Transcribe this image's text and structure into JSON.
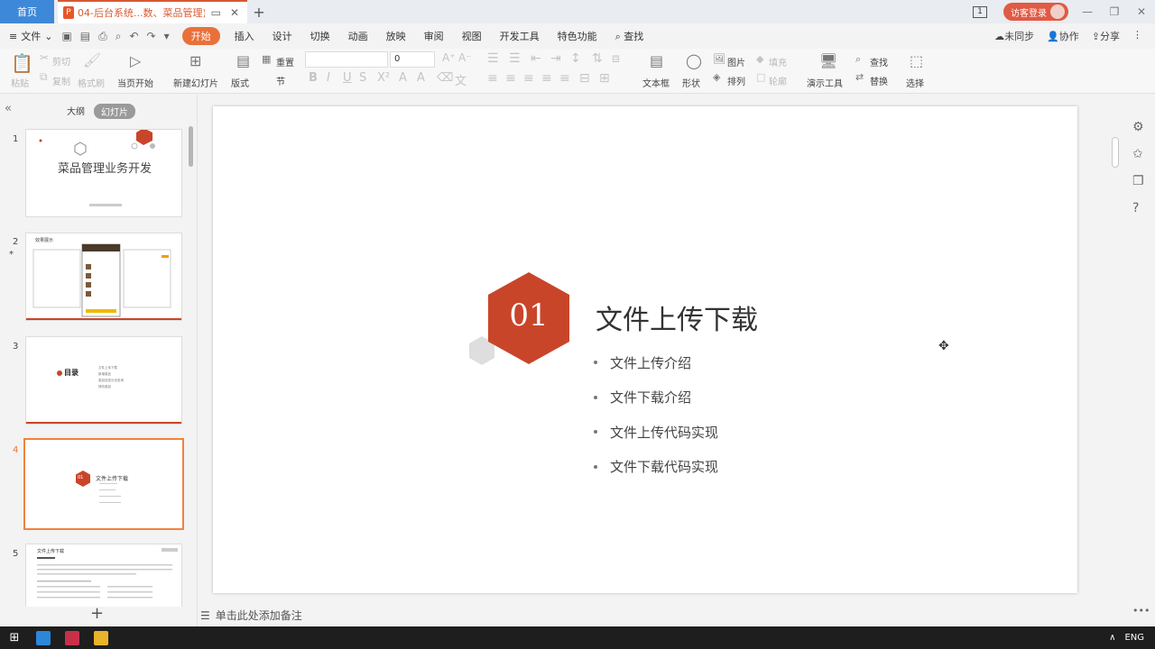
{
  "titlebar": {
    "home_tab": "首页",
    "doc_tab_title": "04-后台系统...数、菜品管理)",
    "doc_badge_count": "1",
    "login_label": "访客登录"
  },
  "menu": {
    "file": "文件",
    "items": [
      "开始",
      "插入",
      "设计",
      "切换",
      "动画",
      "放映",
      "审阅",
      "视图",
      "开发工具",
      "特色功能"
    ],
    "search": "查找",
    "right": [
      "未同步",
      "协作",
      "分享"
    ]
  },
  "ribbon": {
    "paste": "粘贴",
    "cut": "剪切",
    "copy": "复制",
    "format_painter": "格式刷",
    "play_from_current": "当页开始",
    "new_slide": "新建幻灯片",
    "layout": "版式",
    "section": "节",
    "reset": "重置",
    "font_size": "0",
    "textbox": "文本框",
    "shape": "形状",
    "picture": "图片",
    "fill": "填充",
    "arrange": "排列",
    "outline": "轮廓",
    "present_tools": "演示工具",
    "find": "查找",
    "replace": "替换",
    "select": "选择"
  },
  "panel": {
    "tab_outline": "大纲",
    "tab_slides": "幻灯片",
    "slides": [
      {
        "num": "1",
        "title": "菜品管理业务开发"
      },
      {
        "num": "2",
        "title": "效果展示"
      },
      {
        "num": "3",
        "title": "目录",
        "items": [
          "文件上传下载",
          "新增菜品",
          "菜品信息分页查询",
          "修改菜品"
        ]
      },
      {
        "num": "4",
        "badge": "01",
        "title": "文件上传下载"
      },
      {
        "num": "5",
        "title": "文件上传下载"
      }
    ]
  },
  "slide": {
    "badge": "01",
    "title": "文件上传下载",
    "bullets": [
      "文件上传介绍",
      "文件下载介绍",
      "文件上传代码实现",
      "文件下载代码实现"
    ]
  },
  "notes": "单击此处添加备注",
  "taskbar": {
    "lang": "ENG"
  }
}
